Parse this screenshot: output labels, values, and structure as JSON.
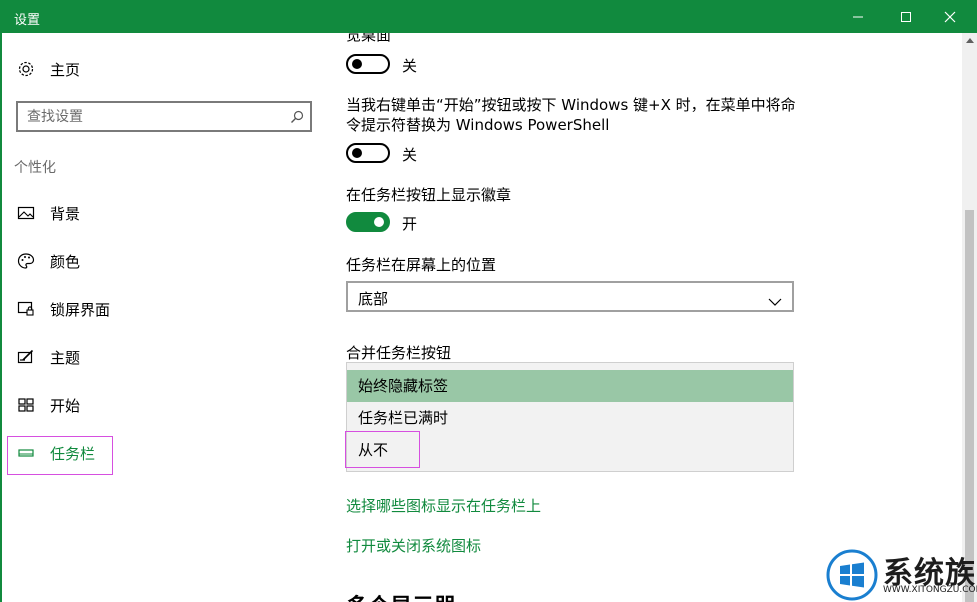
{
  "window": {
    "title": "设置",
    "minimize_icon": "minimize-icon",
    "maximize_icon": "maximize-icon",
    "close_icon": "close-icon"
  },
  "sidebar": {
    "home": {
      "label": "主页",
      "icon": "gear-icon"
    },
    "search": {
      "placeholder": "查找设置",
      "icon": "search-icon"
    },
    "section_title": "个性化",
    "items": [
      {
        "label": "背景",
        "icon": "picture-icon"
      },
      {
        "label": "颜色",
        "icon": "palette-icon"
      },
      {
        "label": "锁屏界面",
        "icon": "lock-screen-icon"
      },
      {
        "label": "主题",
        "icon": "theme-icon"
      },
      {
        "label": "开始",
        "icon": "start-icon"
      },
      {
        "label": "任务栏",
        "icon": "taskbar-icon",
        "selected": true
      }
    ]
  },
  "main": {
    "peek_label_partial": "览桌面",
    "peek_toggle": {
      "state": "关",
      "on": false
    },
    "powershell_setting": {
      "line1": "当我右键单击“开始”按钮或按下 Windows 键+X 时，在菜单中将命",
      "line2": "令提示符替换为 Windows PowerShell",
      "toggle": {
        "state": "关",
        "on": false
      }
    },
    "badges_setting": {
      "label": "在任务栏按钮上显示徽章",
      "toggle": {
        "state": "开",
        "on": true
      }
    },
    "position_setting": {
      "label": "任务栏在屏幕上的位置",
      "value": "底部"
    },
    "combine_setting": {
      "label": "合并任务栏按钮",
      "options": [
        "始终隐藏标签",
        "任务栏已满时",
        "从不"
      ],
      "selected_index": 0
    },
    "links": {
      "choose_icons": "选择哪些图标显示在任务栏上",
      "system_icons": "打开或关闭系统图标"
    },
    "next_section_partial": "多个显示器"
  },
  "watermark": {
    "text": "系统族",
    "url": "WWW.XITONGZU.COM"
  },
  "colors": {
    "accent": "#118a3e",
    "selected_option": "#99c7a6",
    "highlight_box": "#d64fe0"
  }
}
